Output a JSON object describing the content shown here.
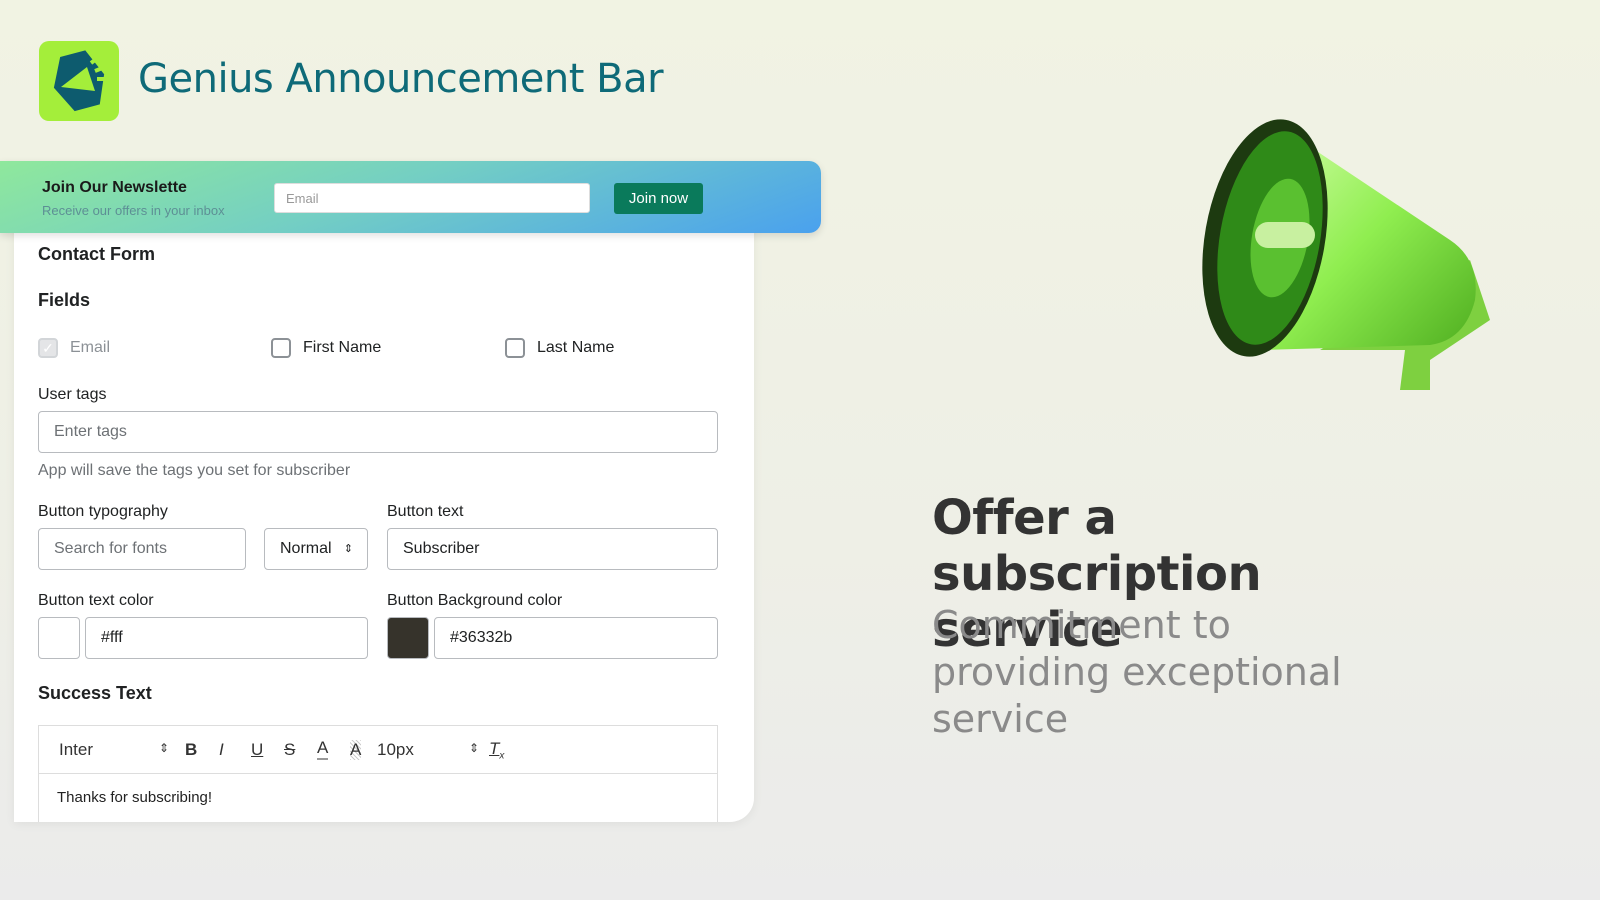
{
  "app": {
    "title": "Genius Announcement Bar",
    "logo_icon": "megaphone-hexagon-icon"
  },
  "bar": {
    "title": "Join Our Newslette",
    "subtitle": "Receive our offers in your inbox",
    "email_placeholder": "Email",
    "join_label": "Join now"
  },
  "form": {
    "title": "Contact Form",
    "fields_heading": "Fields",
    "fields": [
      {
        "label": "Email",
        "checked": true,
        "disabled": true
      },
      {
        "label": "First Name",
        "checked": false
      },
      {
        "label": "Last Name",
        "checked": false
      }
    ],
    "user_tags": {
      "label": "User tags",
      "placeholder": "Enter tags",
      "help": "App will save the tags you set for subscriber"
    },
    "typography": {
      "label": "Button typography",
      "font_placeholder": "Search for fonts",
      "weight": "Normal"
    },
    "button_text": {
      "label": "Button text",
      "value": "Subscriber"
    },
    "text_color": {
      "label": "Button text color",
      "value": "#fff",
      "swatch": "#ffffff"
    },
    "bg_color": {
      "label": "Button Background color",
      "value": "#36332b",
      "swatch": "#36332b"
    },
    "success": {
      "heading": "Success Text",
      "font": "Inter",
      "size": "10px",
      "content": "Thanks for subscribing!"
    }
  },
  "promo": {
    "headline": "Offer a subscription service",
    "subline": "Commitment to providing exceptional service",
    "image_icon": "megaphone-icon"
  }
}
